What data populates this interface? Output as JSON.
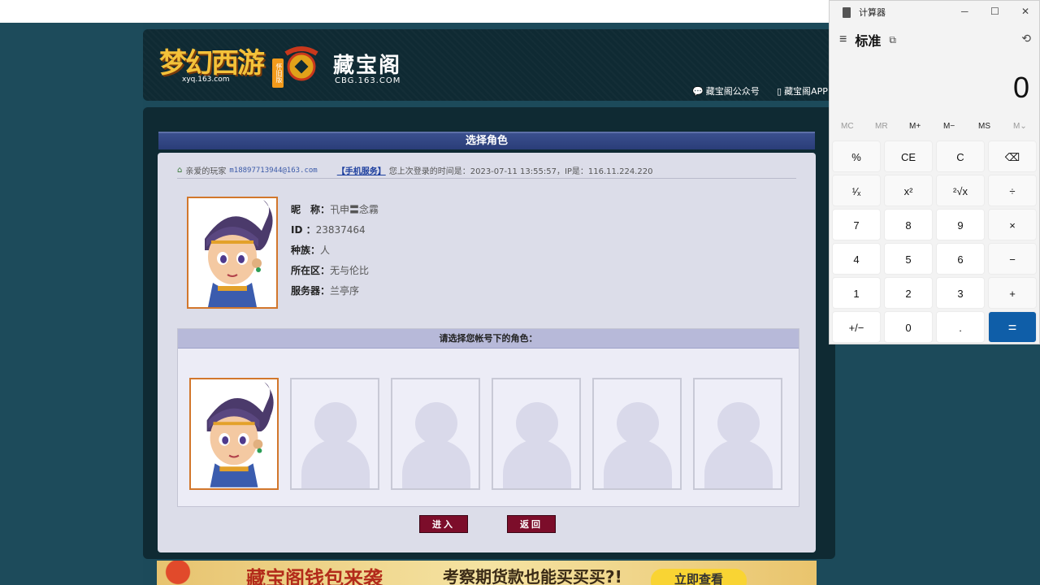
{
  "header": {
    "game_logo_text": "梦幻西游",
    "game_logo_sub": "xyq.163.com",
    "game_badge": "怀旧版",
    "cbg_title": "藏宝阁",
    "cbg_url": "CBG.163.COM",
    "wechat_link": "藏宝阁公众号",
    "app_link": "藏宝阁APP"
  },
  "page": {
    "title": "选择角色",
    "welcome_prefix": "亲爱的玩家",
    "account": "m18897713944@163.com",
    "mobile_service": "【手机服务】",
    "last_login": "您上次登录的时间是：2023-07-11 13:55:57，IP是：116.11.224.220"
  },
  "role": {
    "nickname_label": "昵　称：",
    "nickname": "卂申〓念霧",
    "id_label": "ID ：",
    "id": "23837464",
    "race_label": "种族：",
    "race": "人",
    "zone_label": "所在区：",
    "zone": "无与伦比",
    "server_label": "服务器：",
    "server": "兰亭序"
  },
  "chooser": {
    "heading": "请选择您帐号下的角色："
  },
  "buttons": {
    "enter": "进入",
    "back": "返回"
  },
  "banner": {
    "text1": "藏宝阁钱包来袭",
    "text2": "考察期货款也能买买买?!",
    "cta": "立即查看"
  },
  "calculator": {
    "title": "计算器",
    "mode": "标准",
    "display": "0",
    "memory": [
      "MC",
      "MR",
      "M+",
      "M−",
      "MS",
      "M⌄"
    ],
    "keys": [
      [
        "%",
        "CE",
        "C",
        "⌫"
      ],
      [
        "¹⁄ₓ",
        "x²",
        "²√x",
        "÷"
      ],
      [
        "7",
        "8",
        "9",
        "×"
      ],
      [
        "4",
        "5",
        "6",
        "−"
      ],
      [
        "1",
        "2",
        "3",
        "+"
      ],
      [
        "+/−",
        "0",
        ".",
        "="
      ]
    ]
  }
}
